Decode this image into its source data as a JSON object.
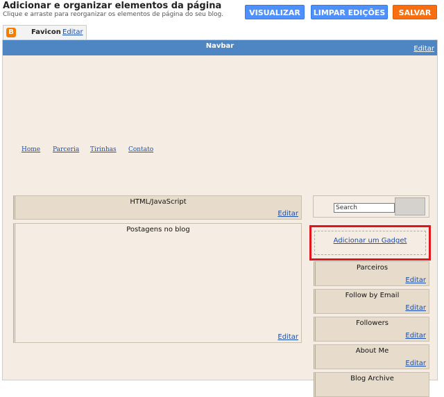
{
  "header": {
    "title": "Adicionar e organizar elementos da página",
    "subtitle": "Clique e arraste para reorganizar os elementos de página do seu blog.",
    "buttons": {
      "preview": "VISUALIZAR",
      "clear": "LIMPAR EDIÇÕES",
      "save": "SALVAR"
    }
  },
  "favicon": {
    "label": "Favicon",
    "edit": "Editar",
    "logo": "B"
  },
  "navbar": {
    "title": "Navbar",
    "edit": "Editar"
  },
  "tabs": [
    "Home",
    "Parceria",
    "Tirinhas",
    "Contato"
  ],
  "main": {
    "html_gadget": {
      "title": "HTML/JavaScript",
      "edit": "Editar"
    },
    "posts": {
      "title": "Postagens no blog",
      "edit": "Editar"
    }
  },
  "sidebar": {
    "search_placeholder": "Search",
    "add_gadget": "Adicionar um Gadget",
    "gadgets": [
      {
        "title": "Parceiros",
        "edit": "Editar"
      },
      {
        "title": "Follow by Email",
        "edit": "Editar"
      },
      {
        "title": "Followers",
        "edit": "Editar"
      },
      {
        "title": "About Me",
        "edit": "Editar"
      },
      {
        "title": "Blog Archive",
        "edit": ""
      }
    ]
  },
  "colors": {
    "navbar": "#4e86c4",
    "canvas": "#f5ece3",
    "gadget": "#e7dccb",
    "highlight": "#e0161c",
    "save": "#f96e11",
    "primary": "#4d90fe"
  }
}
